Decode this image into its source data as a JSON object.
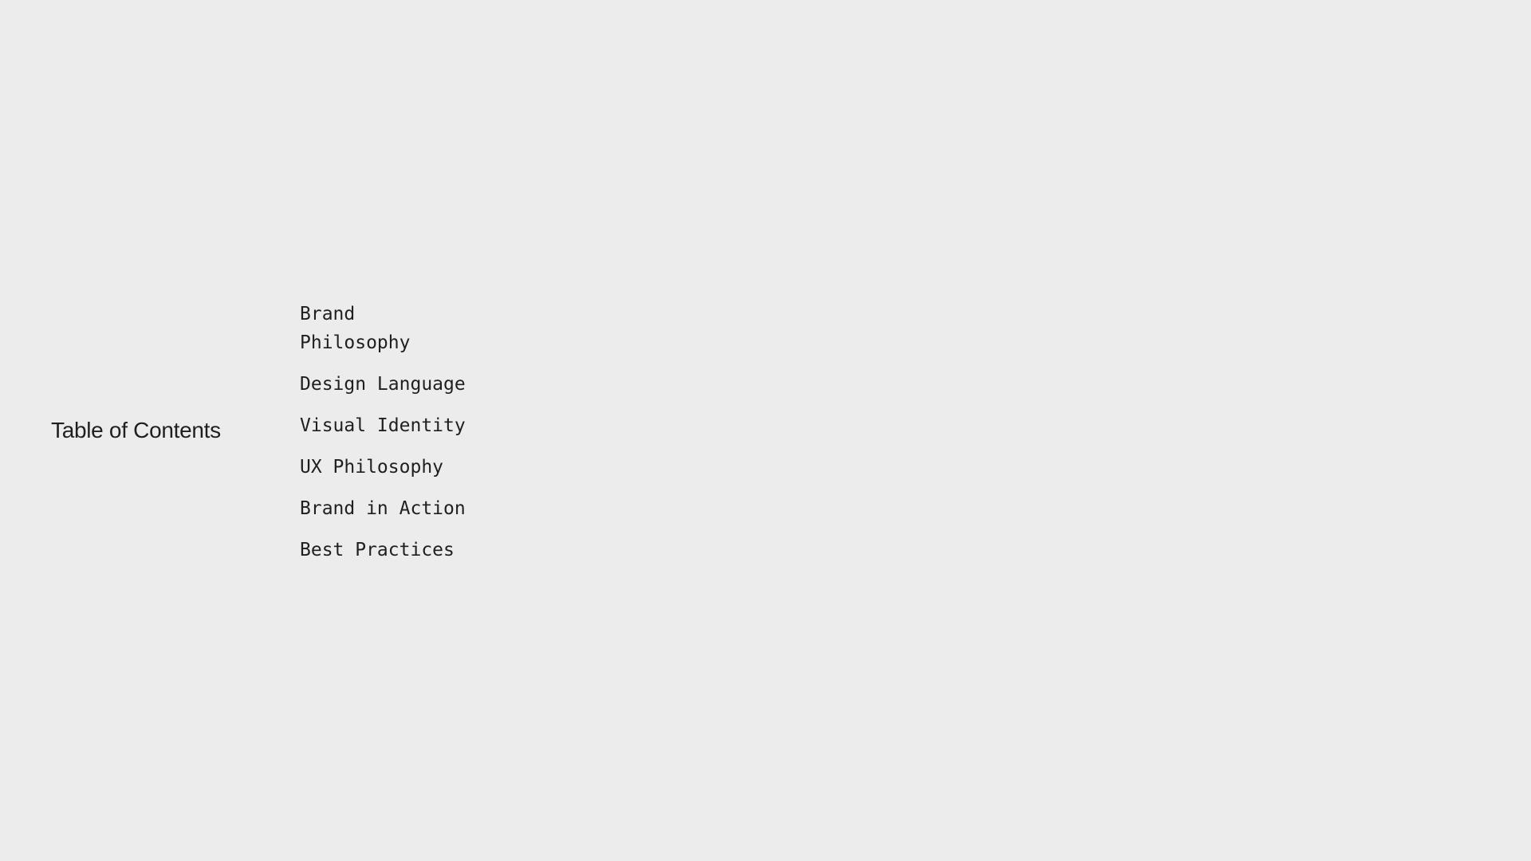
{
  "heading": "Table of Contents",
  "toc": {
    "items": [
      {
        "label": "Brand Philosophy"
      },
      {
        "label": "Design Language"
      },
      {
        "label": "Visual Identity"
      },
      {
        "label": "UX Philosophy"
      },
      {
        "label": "Brand in Action"
      },
      {
        "label": "Best Practices"
      }
    ]
  },
  "colors": {
    "background": "#ececec",
    "text": "#1f1f1f"
  }
}
